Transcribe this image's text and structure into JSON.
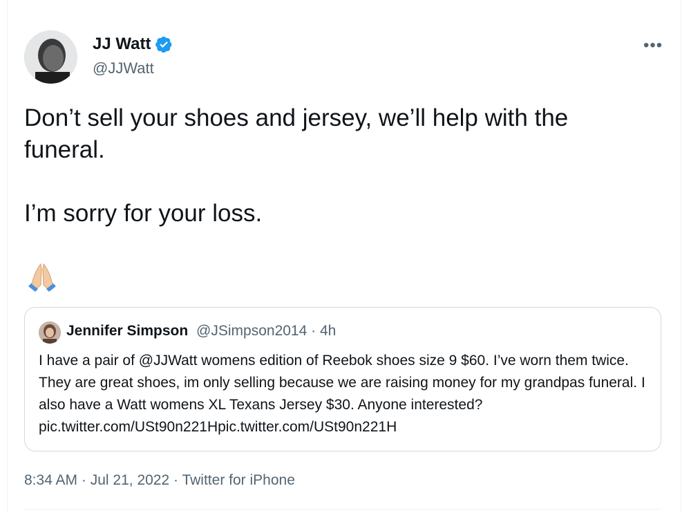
{
  "tweet": {
    "author": {
      "name": "JJ Watt",
      "handle": "@JJWatt",
      "verified": true
    },
    "more_label": "•••",
    "text_line1": "Don’t sell your shoes and jersey, we’ll help with the funeral.",
    "text_line2": "I’m sorry for your loss.",
    "emoji": "folded-hands-icon",
    "quoted": {
      "name": "Jennifer Simpson",
      "handle": "@JSimpson2014",
      "separator": " · ",
      "time": "4h",
      "text": "I have a pair of @JJWatt womens edition of Reebok shoes size 9 $60. I’ve worn them twice. They are great shoes, im only selling because we are raising money for my grandpas funeral. I also have a Watt womens XL Texans Jersey $30. Anyone interested? pic.twitter.com/USt90n221Hpic.twitter.com/USt90n221H"
    },
    "footer": {
      "time": "8:34 AM",
      "sep": " · ",
      "date": "Jul 21, 2022",
      "source": "Twitter for iPhone"
    }
  },
  "colors": {
    "text": "#0f1419",
    "secondary": "#536471",
    "verified": "#1d9bf0",
    "border": "#cfd9de"
  }
}
